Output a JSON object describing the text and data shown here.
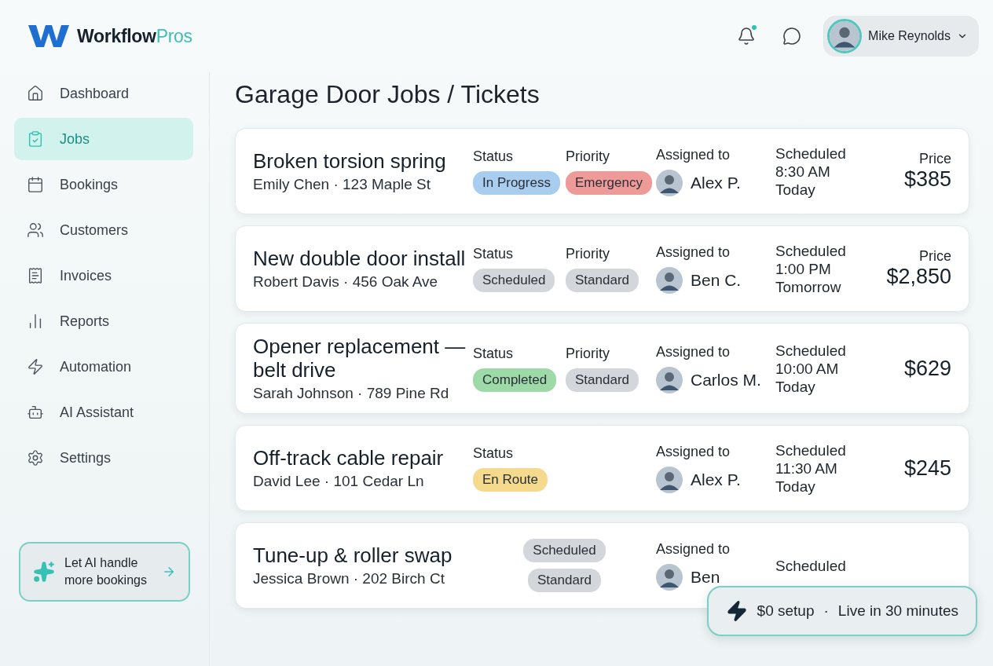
{
  "brand": {
    "name": "Workflow",
    "accent": "Pros"
  },
  "header": {
    "notification_dot": true,
    "user": {
      "name": "Mike Reynolds"
    }
  },
  "sidebar": {
    "items": [
      {
        "label": "Dashboard",
        "selected": false
      },
      {
        "label": "Jobs",
        "selected": true
      },
      {
        "label": "Bookings",
        "selected": false
      },
      {
        "label": "Customers",
        "selected": false
      },
      {
        "label": "Invoices",
        "selected": false
      },
      {
        "label": "Reports",
        "selected": false
      },
      {
        "label": "Automation",
        "selected": false
      },
      {
        "label": "AI Assistant",
        "selected": false
      },
      {
        "label": "Settings",
        "selected": false
      }
    ],
    "promo": {
      "text_line_1": "Let AI handle",
      "text_line_2": "more bookings"
    }
  },
  "page_title": "Garage Door Jobs / Tickets",
  "jobs": [
    {
      "kind": "labeled",
      "title": "Broken torsion spring",
      "customer": "Emily Chen · 123 Maple St",
      "status_label": "Status",
      "status": {
        "label": "In Progress",
        "color": "#a9cdee"
      },
      "priority_label": "Priority",
      "priority": {
        "label": "Emergency",
        "color": "#ee9a98"
      },
      "assigned_label": "Assigned to",
      "assignee": "Alex P.",
      "scheduled_label": "Scheduled",
      "time": "8:30 AM",
      "day": "Today",
      "price_label": "Price",
      "price": "$385"
    },
    {
      "kind": "labeled",
      "title": "New double door install",
      "customer": "Robert Davis · 456 Oak Ave",
      "status_label": "Status",
      "status": {
        "label": "Scheduled",
        "color": "#d3d6da"
      },
      "priority_label": "Priority",
      "priority": {
        "label": "Standard",
        "color": "#d3d6da"
      },
      "assigned_label": "Assigned to",
      "assignee": "Ben C.",
      "scheduled_label": "Scheduled",
      "time": "1:00 PM",
      "day": "Tomorrow",
      "price_label": "Price",
      "price": "$2,850"
    },
    {
      "kind": "labeled",
      "title": "Opener replacement — belt drive",
      "customer": "Sarah Johnson · 789 Pine Rd",
      "status_label": "Status",
      "status": {
        "label": "Completed",
        "color": "#9ed9a8"
      },
      "priority_label": "Priority",
      "priority": {
        "label": "Standard",
        "color": "#d3d6da"
      },
      "assigned_label": "Assigned to",
      "assignee": "Carlos M.",
      "scheduled_label": "Scheduled",
      "time": "10:00 AM",
      "day": "Today",
      "price": "$629"
    },
    {
      "kind": "labeled",
      "title": "Off-track cable repair",
      "customer": "David Lee · 101 Cedar Ln",
      "status_label": "Status",
      "status": {
        "label": "En Route",
        "color": "#f5da8e"
      },
      "assigned_label": "Assigned to",
      "assignee": "Alex P.",
      "scheduled_label": "Scheduled",
      "time": "11:30 AM",
      "day": "Today",
      "price": "$245"
    },
    {
      "kind": "stacked",
      "title": "Tune-up & roller swap",
      "customer": "Jessica Brown · 202 Birch Ct",
      "status": {
        "label": "Scheduled",
        "color": "#d3d6da"
      },
      "priority": {
        "label": "Standard",
        "color": "#d3d6da"
      },
      "assigned_label": "Assigned to",
      "assignee": "Ben",
      "scheduled_label": "Scheduled"
    }
  ],
  "toast": {
    "setup": "$0 setup",
    "separator": "·",
    "live": "Live in 30 minutes"
  }
}
